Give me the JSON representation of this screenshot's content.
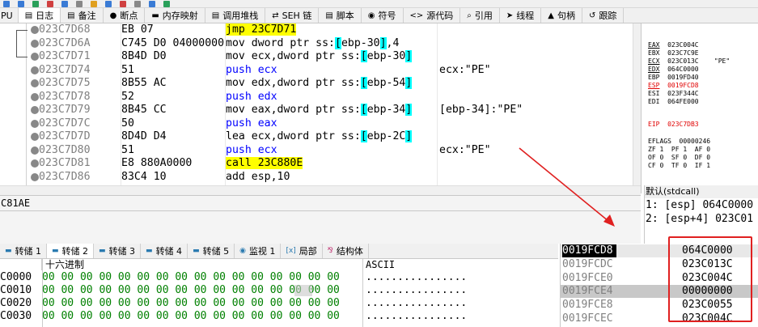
{
  "tabs": [
    {
      "label": "PU",
      "icon": ""
    },
    {
      "label": "日志",
      "icon": "▤"
    },
    {
      "label": "备注",
      "icon": "▤"
    },
    {
      "label": "断点",
      "icon": "●"
    },
    {
      "label": "内存映射",
      "icon": "▬"
    },
    {
      "label": "调用堆栈",
      "icon": "▤"
    },
    {
      "label": "SEH 链",
      "icon": "⇄"
    },
    {
      "label": "脚本",
      "icon": "▤"
    },
    {
      "label": "符号",
      "icon": "◉"
    },
    {
      "label": "源代码",
      "icon": "<>"
    },
    {
      "label": "引用",
      "icon": "⌕"
    },
    {
      "label": "线程",
      "icon": "➤"
    },
    {
      "label": "句柄",
      "icon": "▲"
    },
    {
      "label": "跟踪",
      "icon": "↺"
    }
  ],
  "disasm": [
    {
      "addr": "023C7D68",
      "bytes": "EB 07",
      "mnem": "jmp",
      "ops": [
        {
          "t": "23C7D71",
          "h": "y"
        }
      ],
      "comment": "",
      "mhl": "y"
    },
    {
      "addr": "023C7D6A",
      "bytes": "C745 D0 04000000",
      "mnem": "mov",
      "ops": [
        {
          "t": "dword ptr ss:"
        },
        {
          "t": "[",
          "h": "c"
        },
        {
          "t": "ebp-30"
        },
        {
          "t": "]",
          "h": "c"
        },
        {
          "t": ",4"
        }
      ],
      "comment": ""
    },
    {
      "addr": "023C7D71",
      "bytes": "8B4D D0",
      "mnem": "mov",
      "ops": [
        {
          "t": "ecx,dword ptr ss:"
        },
        {
          "t": "[",
          "h": "c"
        },
        {
          "t": "ebp-30"
        },
        {
          "t": "]",
          "h": "c"
        }
      ],
      "comment": ""
    },
    {
      "addr": "023C7D74",
      "bytes": "51",
      "mnem": "push",
      "ops": [
        {
          "t": "ecx"
        }
      ],
      "comment": "ecx:\"PE\"",
      "blue": true
    },
    {
      "addr": "023C7D75",
      "bytes": "8B55 AC",
      "mnem": "mov",
      "ops": [
        {
          "t": "edx,dword ptr ss:"
        },
        {
          "t": "[",
          "h": "c"
        },
        {
          "t": "ebp-54"
        },
        {
          "t": "]",
          "h": "c"
        }
      ],
      "comment": ""
    },
    {
      "addr": "023C7D78",
      "bytes": "52",
      "mnem": "push",
      "ops": [
        {
          "t": "edx"
        }
      ],
      "comment": "",
      "blue": true
    },
    {
      "addr": "023C7D79",
      "bytes": "8B45 CC",
      "mnem": "mov",
      "ops": [
        {
          "t": "eax,dword ptr ss:"
        },
        {
          "t": "[",
          "h": "c"
        },
        {
          "t": "ebp-34"
        },
        {
          "t": "]",
          "h": "c"
        }
      ],
      "comment": "[ebp-34]:\"PE\""
    },
    {
      "addr": "023C7D7C",
      "bytes": "50",
      "mnem": "push",
      "ops": [
        {
          "t": "eax"
        }
      ],
      "comment": "",
      "blue": true
    },
    {
      "addr": "023C7D7D",
      "bytes": "8D4D D4",
      "mnem": "lea",
      "ops": [
        {
          "t": "ecx,dword ptr ss:"
        },
        {
          "t": "[",
          "h": "c"
        },
        {
          "t": "ebp-2C"
        },
        {
          "t": "]",
          "h": "c"
        }
      ],
      "comment": ""
    },
    {
      "addr": "023C7D80",
      "bytes": "51",
      "mnem": "push",
      "ops": [
        {
          "t": "ecx"
        }
      ],
      "comment": "ecx:\"PE\"",
      "blue": true
    },
    {
      "addr": "023C7D81",
      "bytes": "E8 880A0000",
      "mnem": "call",
      "ops": [
        {
          "t": "23C880E",
          "h": "y"
        }
      ],
      "comment": "",
      "mhl": "y"
    },
    {
      "addr": "023C7D86",
      "bytes": "83C4 10",
      "mnem": "add",
      "ops": [
        {
          "t": "esp,10"
        }
      ],
      "comment": ""
    }
  ],
  "registers": [
    {
      "name": "EAX",
      "val": "023C004C",
      "extra": "",
      "red": false,
      "u": true
    },
    {
      "name": "EBX",
      "val": "023C7C9E",
      "extra": "",
      "red": false
    },
    {
      "name": "ECX",
      "val": "023C013C",
      "extra": "\"PE\"",
      "red": false,
      "u": true
    },
    {
      "name": "EDX",
      "val": "064C0000",
      "extra": "",
      "red": false,
      "u": true
    },
    {
      "name": "EBP",
      "val": "0019FD40",
      "extra": "",
      "red": false
    },
    {
      "name": "ESP",
      "val": "0019FCD8",
      "extra": "",
      "red": true,
      "u": true
    },
    {
      "name": "ESI",
      "val": "023F344C",
      "extra": "",
      "red": false
    },
    {
      "name": "EDI",
      "val": "064FE000",
      "extra": "",
      "red": false
    },
    {
      "name": "EIP",
      "val": "023C7DB3",
      "extra": "",
      "red": true
    },
    {
      "name": "EFLAGS",
      "val": "00000246",
      "extra": "",
      "red": false
    },
    {
      "name": "ZF 1",
      "val": "PF 1  AF 0",
      "extra": "",
      "red": false
    },
    {
      "name": "OF 0",
      "val": "SF 0  DF 0",
      "extra": "",
      "red": false
    },
    {
      "name": "CF 0",
      "val": "TF 0  IF 1",
      "extra": "",
      "red": false
    }
  ],
  "info_line": "C81AE",
  "callstack": {
    "title": "默认(stdcall)",
    "rows": [
      "1: [esp] 064C0000",
      "2: [esp+4] 023C01"
    ]
  },
  "dump_tabs": [
    "转储 1",
    "转储 2",
    "转储 3",
    "转储 4",
    "转储 5",
    "监视 1",
    "局部",
    "结构体"
  ],
  "dump_header": {
    "hex": "十六进制",
    "ascii": "ASCII"
  },
  "dump_rows": [
    {
      "addr": "C0000",
      "hex": "00 00 00 00 00 00 00 00 00 00 00 00 00 00 00 00",
      "ascii": "................"
    },
    {
      "addr": "C0010",
      "hex": "00 00 00 00 00 00 00 00 00 00 00 00 00 00 00 00",
      "ascii": "................"
    },
    {
      "addr": "C0020",
      "hex": "00 00 00 00 00 00 00 00 00 00 00 00 00 00 00 00",
      "ascii": "................"
    },
    {
      "addr": "C0030",
      "hex": "00 00 00 00 00 00 00 00 00 00 00 00 00 00 00 00",
      "ascii": "................"
    }
  ],
  "stack_rows": [
    {
      "addr": "0019FCD8",
      "val": "064C0000",
      "state": "cur"
    },
    {
      "addr": "0019FCDC",
      "val": "023C013C",
      "state": ""
    },
    {
      "addr": "0019FCE0",
      "val": "023C004C",
      "state": ""
    },
    {
      "addr": "0019FCE4",
      "val": "00000000",
      "state": "gray"
    },
    {
      "addr": "0019FCE8",
      "val": "023C0055",
      "state": ""
    },
    {
      "addr": "0019FCEC",
      "val": "023C004C",
      "state": ""
    }
  ],
  "colors": {
    "highlight_yellow": "#ffff00",
    "highlight_cyan": "#00ffff",
    "annotation_red": "#e02020",
    "hex_green": "#008000"
  }
}
